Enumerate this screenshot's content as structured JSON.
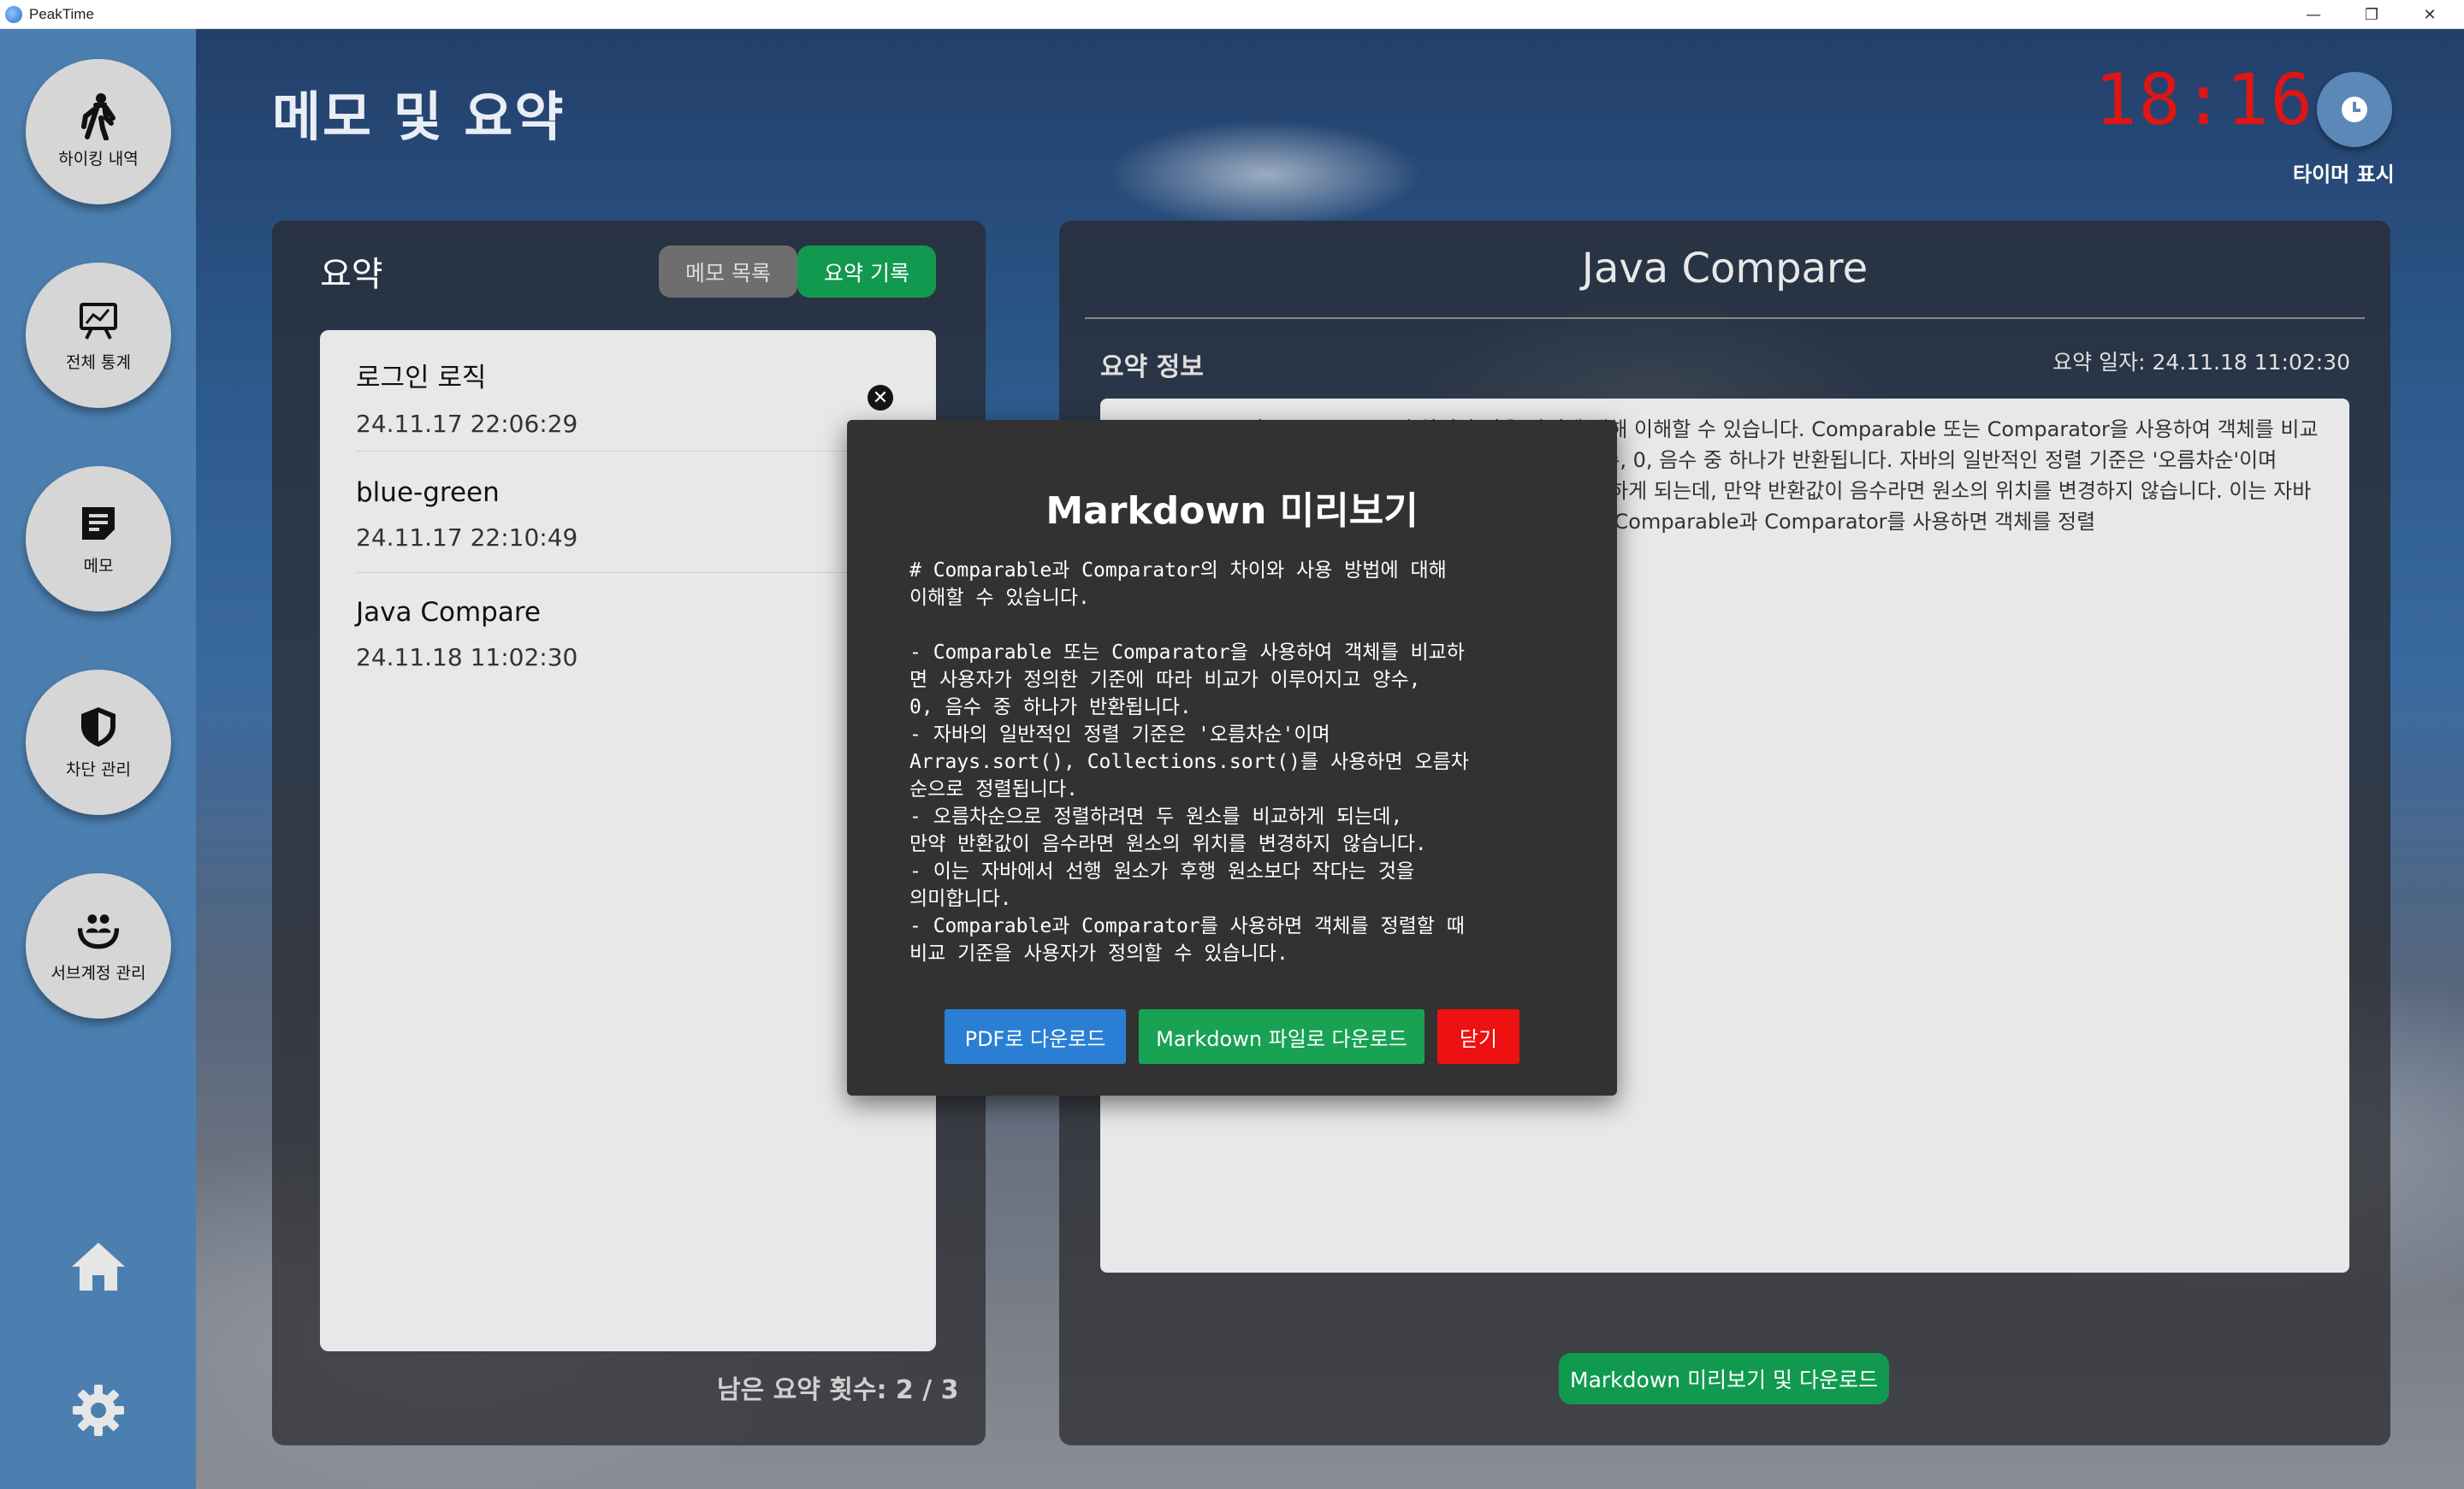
{
  "window": {
    "title": "PeakTime",
    "controls": [
      "—",
      "❐",
      "✕"
    ]
  },
  "sidebar": {
    "items": [
      {
        "label": "하이킹 내역",
        "icon": "hiker-icon"
      },
      {
        "label": "전체 통계",
        "icon": "chart-board-icon"
      },
      {
        "label": "메모",
        "icon": "memo-icon"
      },
      {
        "label": "차단 관리",
        "icon": "shield-icon"
      },
      {
        "label": "서브계정 관리",
        "icon": "people-hands-icon"
      }
    ],
    "home_icon": "home-icon",
    "settings_icon": "gear-icon"
  },
  "header": {
    "title": "메모 및 요약",
    "clock": "18:16",
    "timer_label": "타이머 표시"
  },
  "left_panel": {
    "heading": "요약",
    "tabs": {
      "memo": "메모 목록",
      "summary": "요약 기록"
    },
    "items": [
      {
        "title": "로그인 로직",
        "date": "24.11.17 22:06:29"
      },
      {
        "title": "blue-green",
        "date": "24.11.17 22:10:49"
      },
      {
        "title": "Java Compare",
        "date": "24.11.18 11:02:30"
      }
    ],
    "remaining": "남은 요약 횟수: 2 / 3"
  },
  "right_panel": {
    "title": "Java Compare",
    "info_label": "요약 정보",
    "date": "요약 일자: 24.11.18 11:02:30",
    "summary_text": "Comparable과 Comparator의 차이와 사용 방법에 대해 이해할 수 있습니다. Comparable 또는 Comparator을 사용하여 객체를 비교하면 사용자가 정의한 기준에 따라 비교가 이루어지고 양수, 0, 음수 중 하나가 반환됩니다. 자바의 일반적인 정렬 기준은 '오름차순'이며 Arrays.sort(). 오름차순으로 정렬하려면 두 원소를 비교하게 되는데, 만약 반환값이 음수라면 원소의 위치를 변경하지 않습니다. 이는 자바에서 선행 원소가 후행 원소보다 작다는 것을 의미합니다. Comparable과 Comparator를 사용하면 객체를 정렬",
    "md_button": "Markdown 미리보기 및 다운로드"
  },
  "modal": {
    "title": "Markdown 미리보기",
    "content": "# Comparable과 Comparator의 차이와 사용 방법에 대해\n이해할 수 있습니다.\n\n- Comparable 또는 Comparator을 사용하여 객체를 비교하\n면 사용자가 정의한 기준에 따라 비교가 이루어지고 양수,\n0, 음수 중 하나가 반환됩니다.\n- 자바의 일반적인 정렬 기준은 '오름차순'이며\nArrays.sort(), Collections.sort()를 사용하면 오름차\n순으로 정렬됩니다.\n- 오름차순으로 정렬하려면 두 원소를 비교하게 되는데,\n만약 반환값이 음수라면 원소의 위치를 변경하지 않습니다.\n- 이는 자바에서 선행 원소가 후행 원소보다 작다는 것을\n의미합니다.\n- Comparable과 Comparator를 사용하면 객체를 정렬할 때\n비교 기준을 사용자가 정의할 수 있습니다.",
    "buttons": {
      "pdf": "PDF로 다운로드",
      "markdown": "Markdown 파일로 다운로드",
      "close": "닫기"
    }
  },
  "colors": {
    "sidebar": "#4b7fb0",
    "clock": "#e01515",
    "green": "#119a4f",
    "pdf_blue": "#2a7fd4",
    "close_red": "#ee1111"
  }
}
